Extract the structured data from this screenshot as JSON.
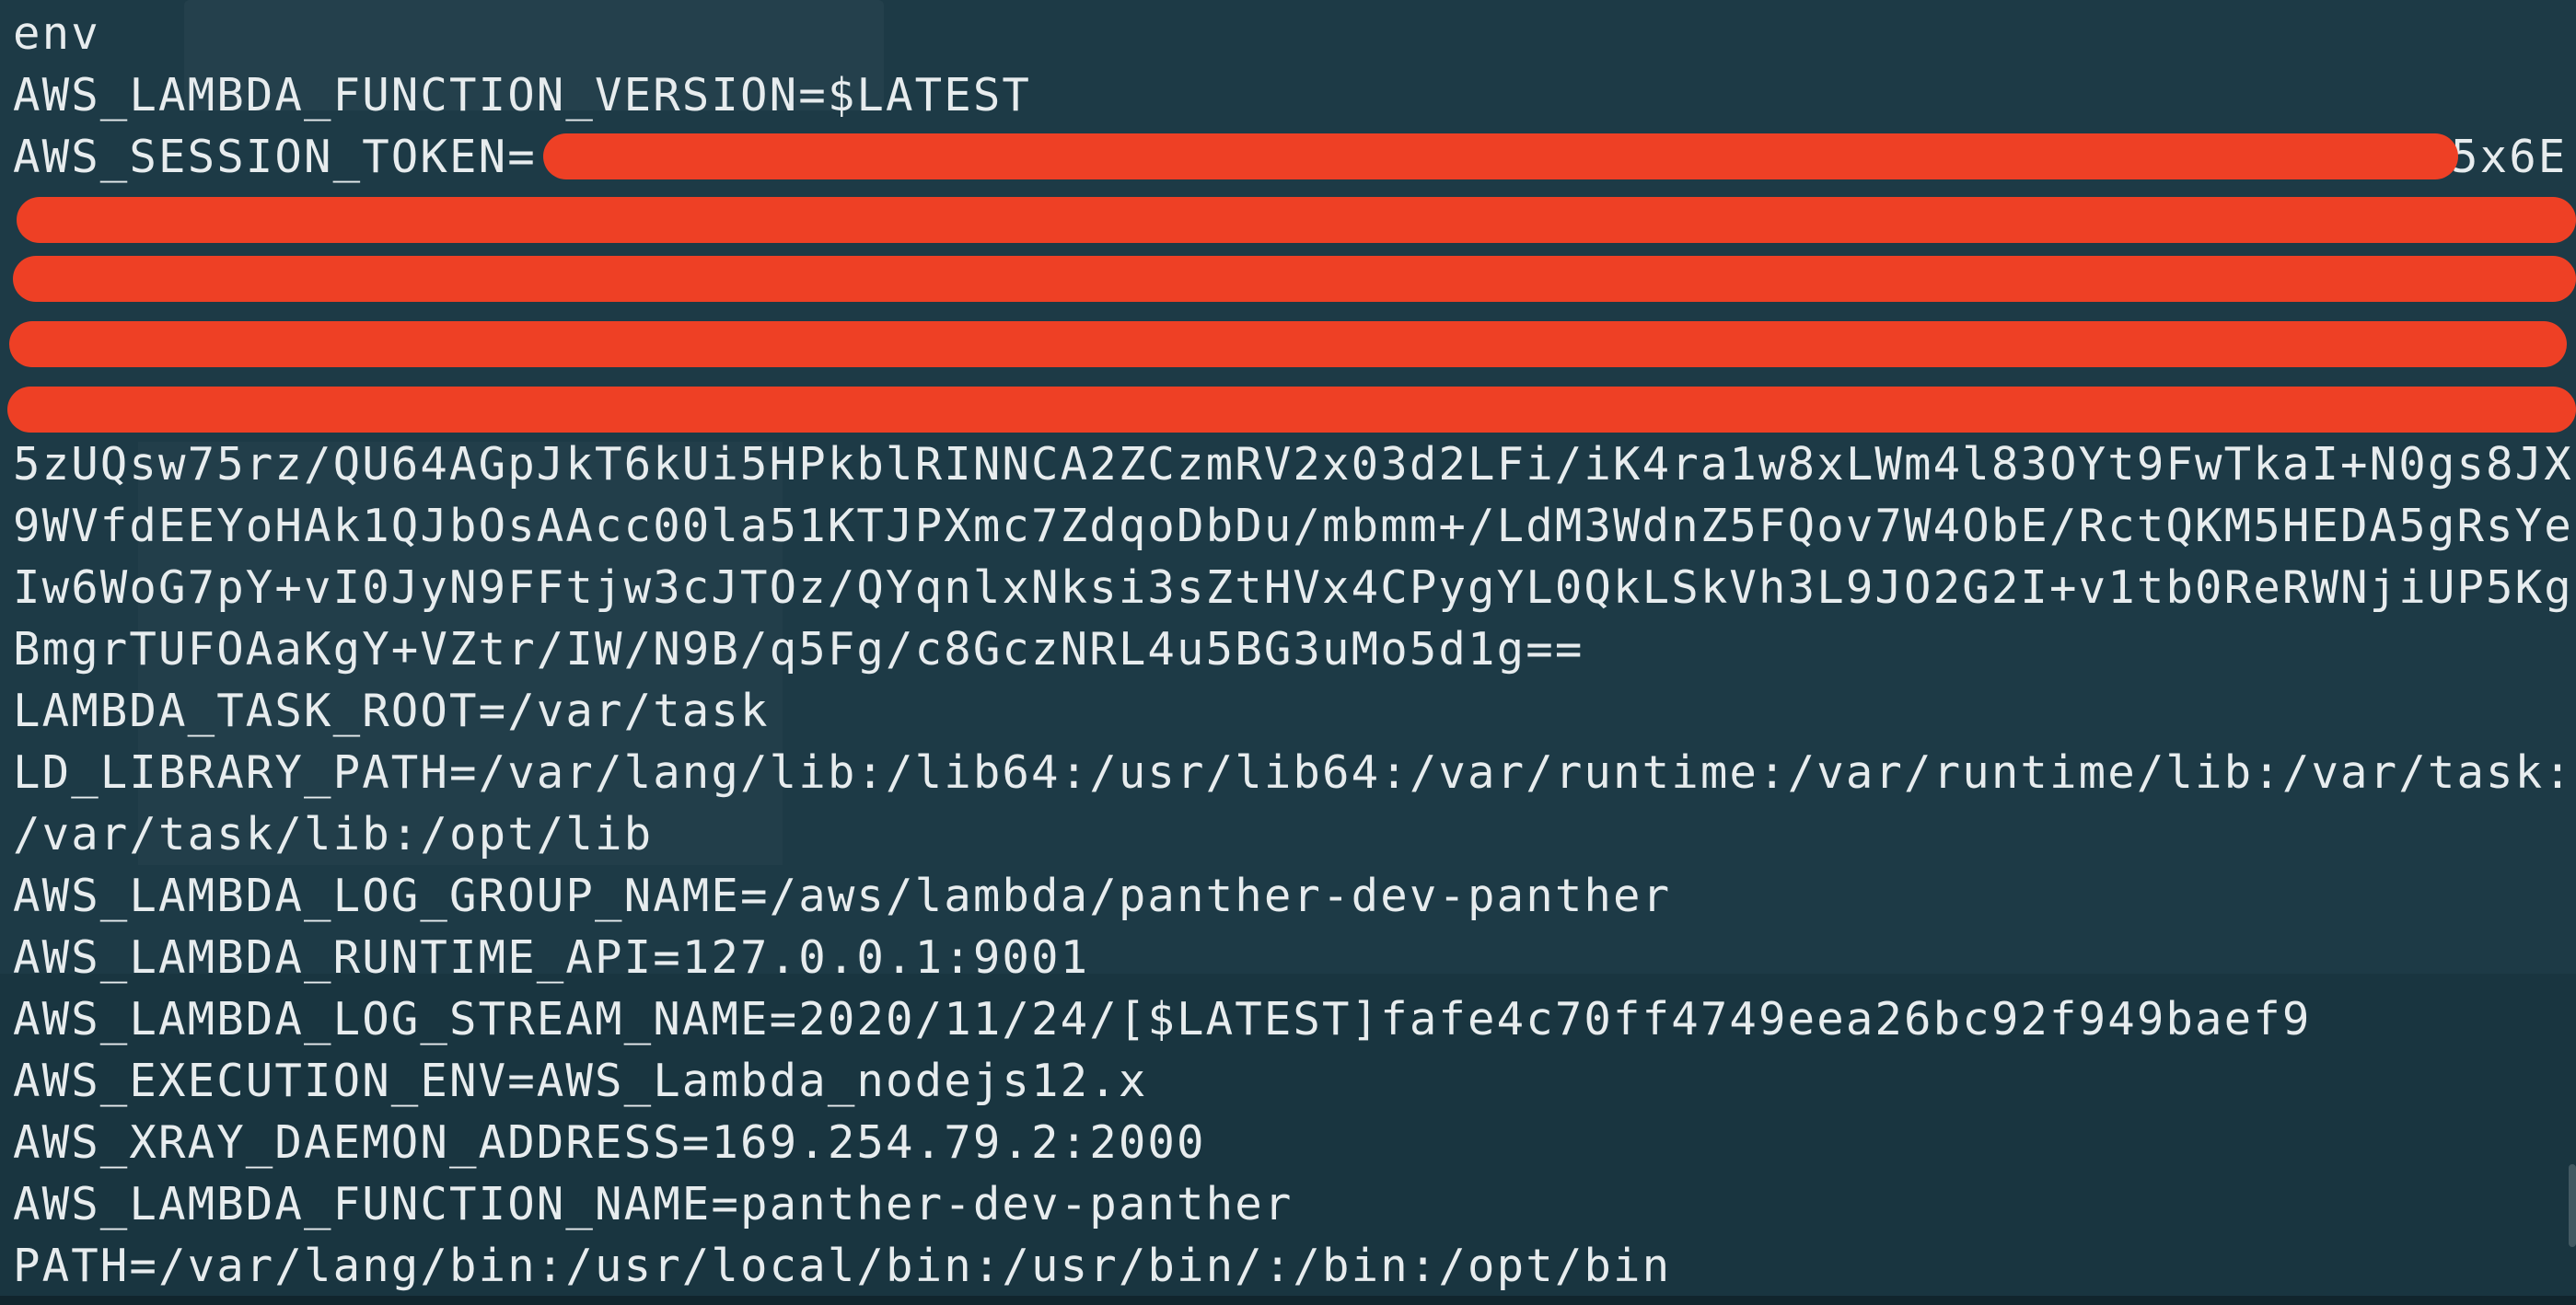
{
  "terminal": {
    "command": "env",
    "lines": {
      "function_version": "AWS_LAMBDA_FUNCTION_VERSION=$LATEST",
      "session_token_prefix": "AWS_SESSION_TOKEN=",
      "session_token_tail_visible": "5x6E",
      "token_line_6": "5zUQsw75rz/QU64AGpJkT6kUi5HPkblRINNCA2ZCzmRV2x03d2LFi/iK4ra1w8xLWm4l83OYt9FwTkaI+N0gs8JX",
      "token_line_7": "9WVfdEEYoHAk1QJbOsAAcc00la51KTJPXmc7ZdqoDbDu/mbmm+/LdM3WdnZ5FQov7W4ObE/RctQKM5HEDA5gRsYe",
      "token_line_8": "Iw6WoG7pY+vI0JyN9FFtjw3cJTOz/QYqnlxNksi3sZtHVx4CPygYL0QkLSkVh3L9JO2G2I+v1tb0ReRWNjiUP5Kg",
      "token_line_9": "BmgrTUFOAaKgY+VZtr/IW/N9B/q5Fg/c8GczNRL4u5BG3uMo5d1g==",
      "task_root": "LAMBDA_TASK_ROOT=/var/task",
      "ld_library_path": "LD_LIBRARY_PATH=/var/lang/lib:/lib64:/usr/lib64:/var/runtime:/var/runtime/lib:/var/task:",
      "ld_library_path_cont": "/var/task/lib:/opt/lib",
      "log_group": "AWS_LAMBDA_LOG_GROUP_NAME=/aws/lambda/panther-dev-panther",
      "runtime_api": "AWS_LAMBDA_RUNTIME_API=127.0.0.1:9001",
      "log_stream": "AWS_LAMBDA_LOG_STREAM_NAME=2020/11/24/[$LATEST]fafe4c70ff4749eea26bc92f949baef9",
      "execution_env": "AWS_EXECUTION_ENV=AWS_Lambda_nodejs12.x",
      "xray_daemon": "AWS_XRAY_DAEMON_ADDRESS=169.254.79.2:2000",
      "function_name": "AWS_LAMBDA_FUNCTION_NAME=panther-dev-panther",
      "path": "PATH=/var/lang/bin:/usr/local/bin:/usr/bin/:/bin:/opt/bin"
    }
  },
  "colors": {
    "background": "#1d3a46",
    "text": "#e7ecee",
    "redaction": "#ee4025"
  }
}
